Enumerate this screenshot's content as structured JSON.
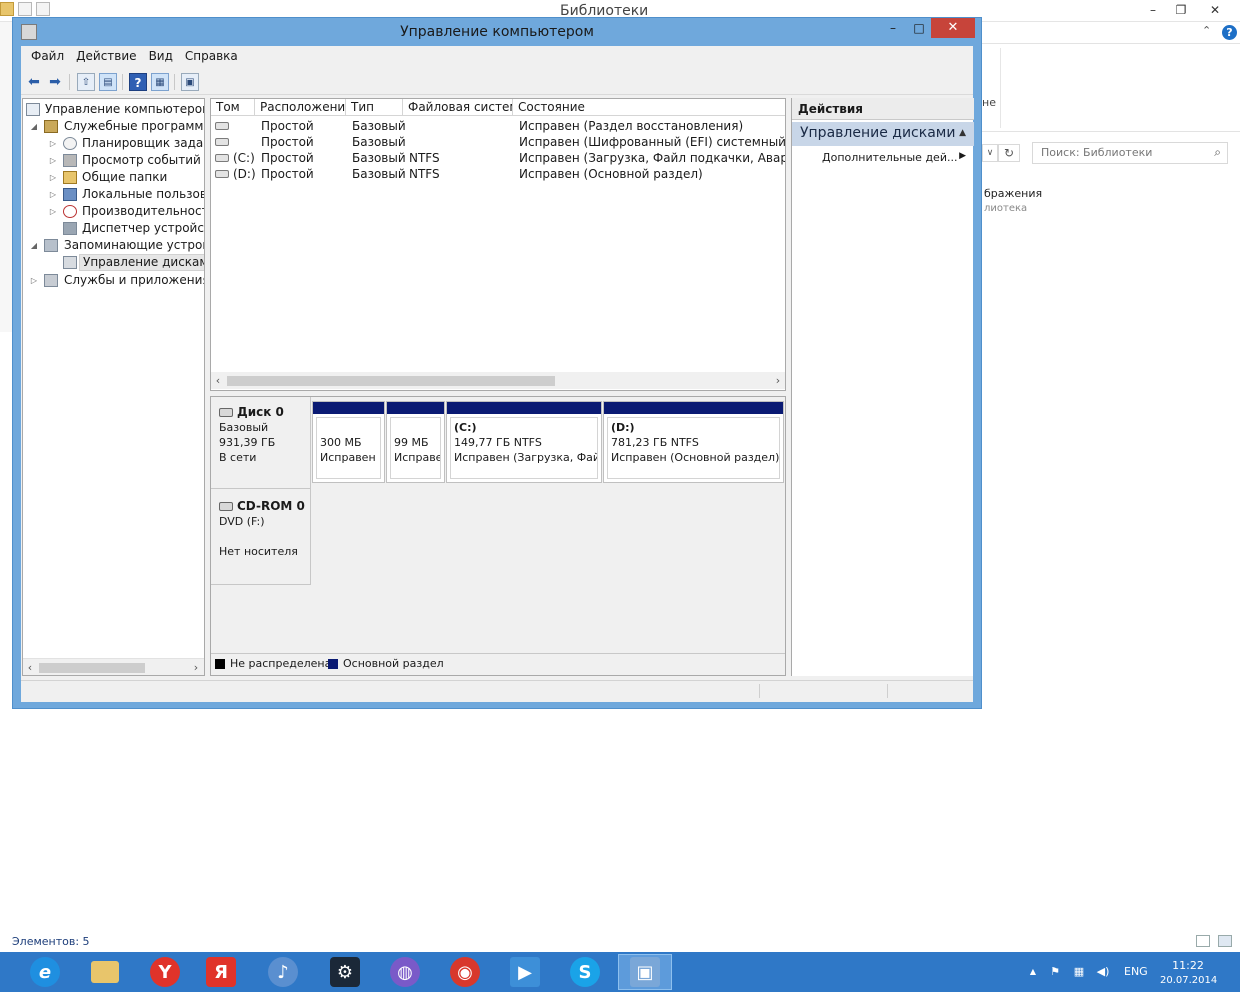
{
  "background_window": {
    "title": "Библиотеки",
    "min_glyph": "–",
    "max_glyph": "❐",
    "close_glyph": "✕",
    "chevron_glyph": "⌃",
    "help_glyph": "?",
    "ribbon_text": "не",
    "refresh_glyph": "↻",
    "dropdown_glyph": "∨",
    "search_placeholder": "Поиск: Библиотеки",
    "search_icon": "⌕",
    "items": [
      "бражения",
      "лиотека"
    ],
    "status": "Элементов: 5"
  },
  "window": {
    "title": "Управление компьютером",
    "min_glyph": "–",
    "max_glyph": "□",
    "close_glyph": "✕"
  },
  "menu": [
    "Файл",
    "Действие",
    "Вид",
    "Справка"
  ],
  "toolbar": {
    "back": "⬅",
    "forward": "➡",
    "up": "⇧",
    "show_tree": "▤",
    "help": "?",
    "view": "▦",
    "props": "▣"
  },
  "tree": {
    "items": [
      {
        "label": "Управление компьютером (л",
        "expander": ""
      },
      {
        "label": "Служебные программы",
        "expander": "◢"
      },
      {
        "label": "Планировщик заданий",
        "expander": "▷"
      },
      {
        "label": "Просмотр событий",
        "expander": "▷"
      },
      {
        "label": "Общие папки",
        "expander": "▷"
      },
      {
        "label": "Локальные пользовате",
        "expander": "▷"
      },
      {
        "label": "Производительность",
        "expander": "▷"
      },
      {
        "label": "Диспетчер устройств",
        "expander": ""
      },
      {
        "label": "Запоминающие устройст",
        "expander": "◢"
      },
      {
        "label": "Управление дисками",
        "expander": ""
      },
      {
        "label": "Службы и приложения",
        "expander": "▷"
      }
    ],
    "scroll_left": "‹",
    "scroll_right": "›"
  },
  "volumes": {
    "columns": [
      "Том",
      "Расположение",
      "Тип",
      "Файловая система",
      "Состояние"
    ],
    "rows": [
      {
        "vol": "",
        "layout": "Простой",
        "type": "Базовый",
        "fs": "",
        "status": "Исправен (Раздел восстановления)"
      },
      {
        "vol": "",
        "layout": "Простой",
        "type": "Базовый",
        "fs": "",
        "status": "Исправен (Шифрованный (EFI) системный раздел"
      },
      {
        "vol": "(C:)",
        "layout": "Простой",
        "type": "Базовый",
        "fs": "NTFS",
        "status": "Исправен (Загрузка, Файл подкачки, Аварийный д"
      },
      {
        "vol": "(D:)",
        "layout": "Простой",
        "type": "Базовый",
        "fs": "NTFS",
        "status": "Исправен (Основной раздел)"
      }
    ],
    "scroll_left": "‹",
    "scroll_right": "›"
  },
  "disks": {
    "disk0": {
      "name": "Диск 0",
      "type": "Базовый",
      "size": "931,39 ГБ",
      "state": "В сети",
      "partitions": [
        {
          "label": "",
          "size": "300 МБ",
          "status": "Исправен ("
        },
        {
          "label": "",
          "size": "99 МБ",
          "status": "Исправе"
        },
        {
          "label": "(C:)",
          "size": "149,77 ГБ NTFS",
          "status": "Исправен (Загрузка, Файл"
        },
        {
          "label": "(D:)",
          "size": "781,23 ГБ NTFS",
          "status": "Исправен (Основной раздел)"
        }
      ]
    },
    "cdrom": {
      "name": "CD-ROM 0",
      "type": "DVD (F:)",
      "state": "Нет носителя"
    },
    "legend": [
      {
        "label": "Не распределена",
        "color": "#000000"
      },
      {
        "label": "Основной раздел",
        "color": "#0a1a73"
      }
    ]
  },
  "actions": {
    "header": "Действия",
    "section": "Управление дисками",
    "section_arrow": "▲",
    "item": "Дополнительные дей...",
    "item_arrow": "▶"
  },
  "taskbar": {
    "apps": [
      {
        "name": "internet-explorer",
        "glyph": "e",
        "color": "#1f8fe0"
      },
      {
        "name": "file-explorer",
        "glyph": "",
        "color": "#e8c56b"
      },
      {
        "name": "yandex-browser",
        "glyph": "Y",
        "color": "#e0332a"
      },
      {
        "name": "yandex",
        "glyph": "Я",
        "color": "#e0332a"
      },
      {
        "name": "media-player",
        "glyph": "♪",
        "color": "#5a8fd0"
      },
      {
        "name": "steam",
        "glyph": "⚙",
        "color": "#1b2838"
      },
      {
        "name": "picasa",
        "glyph": "◍",
        "color": "#7a5ac8"
      },
      {
        "name": "chrome",
        "glyph": "◉",
        "color": "#d8382c"
      },
      {
        "name": "video-player",
        "glyph": "▶",
        "color": "#3d8fd8"
      },
      {
        "name": "skype",
        "glyph": "S",
        "color": "#1aa3e8"
      },
      {
        "name": "computer-management",
        "glyph": "▣",
        "color": "#7aa7d8"
      }
    ],
    "tray_arrow": "▲",
    "tray_flag": "⚑",
    "tray_network": "▦",
    "tray_volume": "◀)",
    "lang": "ENG",
    "time": "11:22",
    "date": "20.07.2014"
  }
}
